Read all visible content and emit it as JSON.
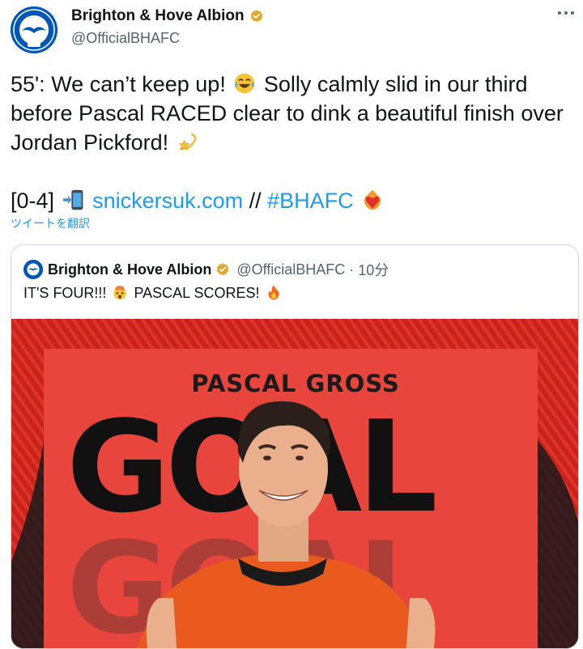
{
  "tweet": {
    "author_name": "Brighton & Hove Albion",
    "author_handle": "@OfficialBHAFC",
    "avatar_icon": "brighton-seagull-crest",
    "verified_icon": "verified-badge-icon",
    "text_line1_a": "55': We can’t keep up!",
    "text_line1_b": "Solly calmly slid in our third",
    "text_line2": "before Pascal RACED clear to dink a beautiful finish over",
    "text_line3": "Jordan Pickford!",
    "score": "[0-4]",
    "link": "snickersuk.com",
    "separator": "//",
    "hashtag": "#BHAFC",
    "translate_label": "ツイートを翻訳"
  },
  "quote": {
    "author_name": "Brighton & Hove Albion",
    "author_handle": "@OfficialBHAFC",
    "dot": "·",
    "time": "10分",
    "text_a": "IT'S FOUR!!!",
    "text_b": "PASCAL SCORES!",
    "media": {
      "player_name": "PASCAL GROSS",
      "headline": "GOAL",
      "ghost_headline": "GOAL"
    }
  },
  "colors": {
    "accent": "#1d9bf0",
    "secondary_text": "#536471",
    "brand_blue": "#0057b8",
    "media_red": "#e8463c"
  }
}
